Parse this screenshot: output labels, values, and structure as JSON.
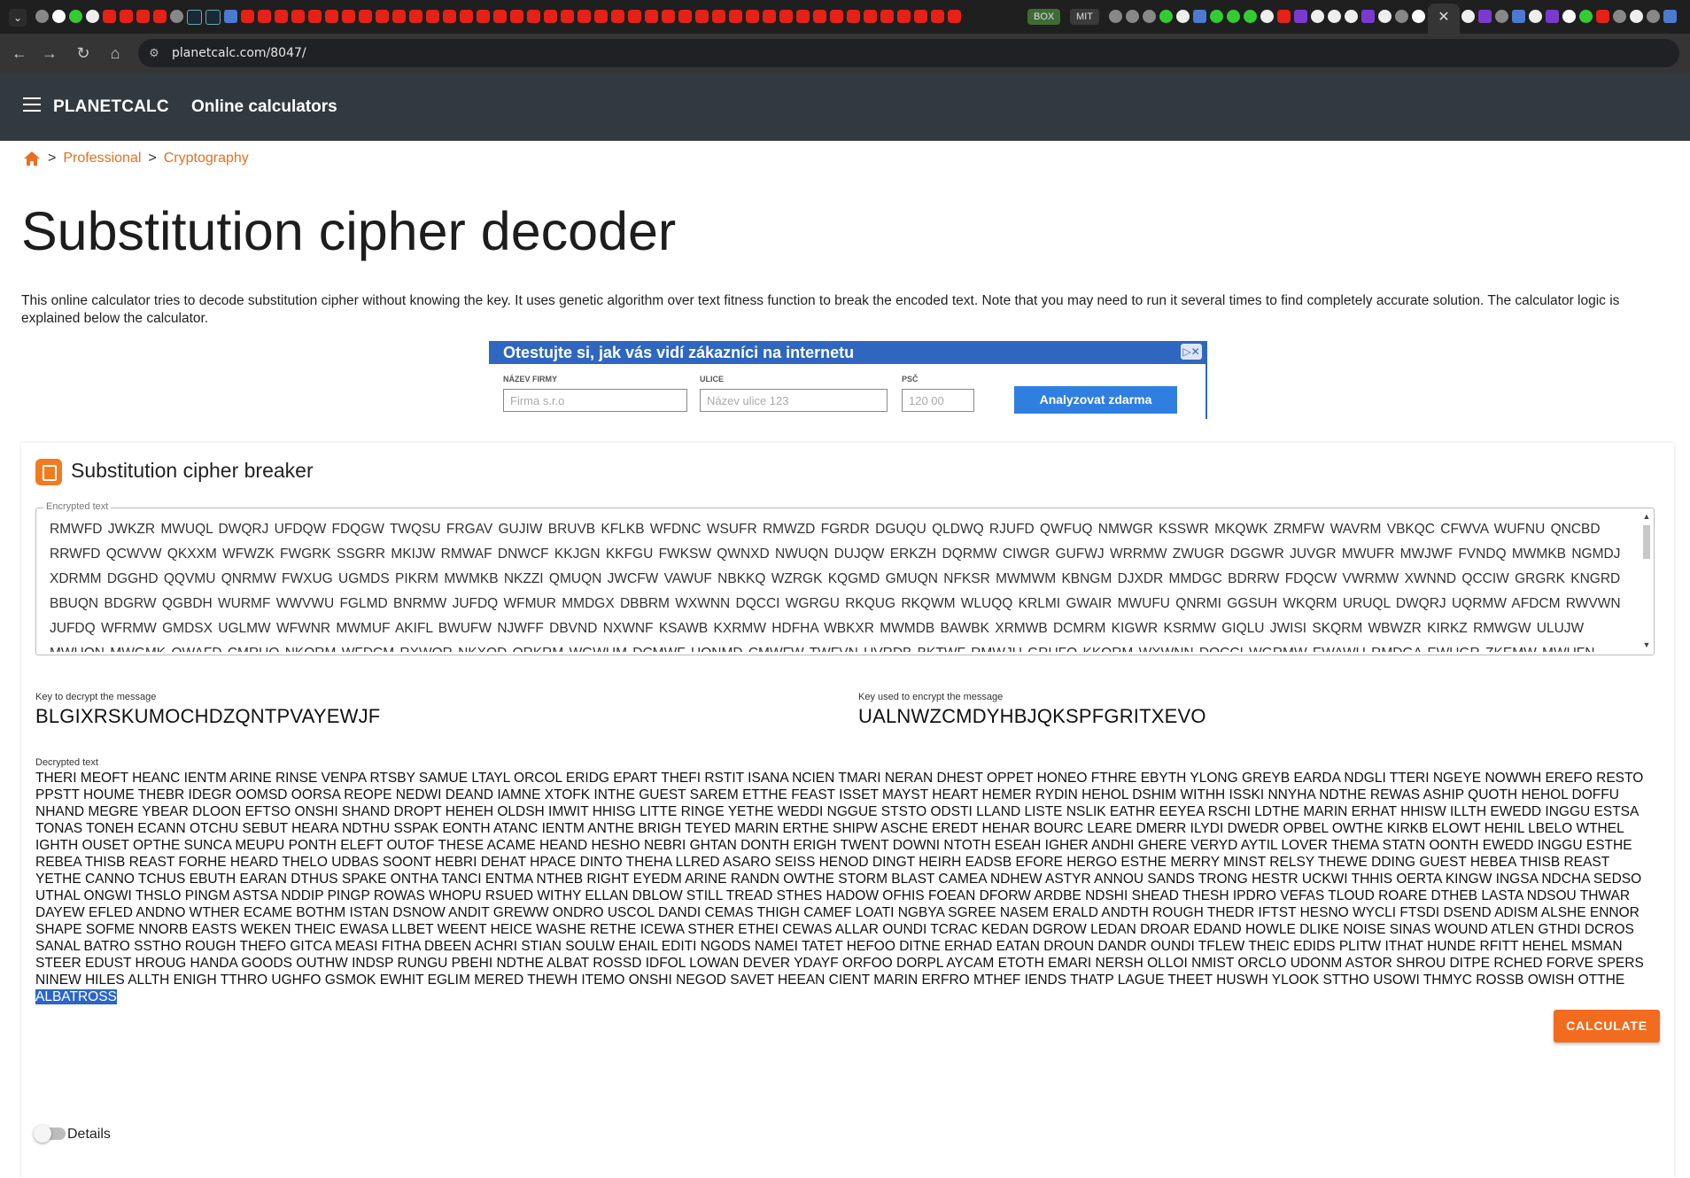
{
  "browser": {
    "tab_labels": {
      "box": "BOX",
      "mit": "MIT"
    },
    "active_tab_close": "✕",
    "url": "planetcalc.com/8047/"
  },
  "header": {
    "brand": "PLANETCALC",
    "nav_item": "Online calculators"
  },
  "breadcrumb": {
    "items": [
      "Professional",
      "Cryptography"
    ],
    "separator": ">"
  },
  "page": {
    "title": "Substitution cipher decoder",
    "intro": "This online calculator tries to decode substitution cipher without knowing the key. It uses genetic algorithm over text fitness function to break the encoded text. Note that you may need to run it several times to find completely accurate solution. The calculator logic is explained below the calculator."
  },
  "ad": {
    "title": "Otestujte si, jak vás vidí zákazníci na internetu",
    "close": "▷✕",
    "fields": [
      {
        "label": "NÁZEV FIRMY",
        "placeholder": "Firma s.r.o"
      },
      {
        "label": "ULICE",
        "placeholder": "Název ulice 123"
      },
      {
        "label": "PSČ",
        "placeholder": "120 00"
      }
    ],
    "button": "Analyzovat zdarma"
  },
  "calculator": {
    "title": "Substitution cipher breaker",
    "encrypted_label": "Encrypted text",
    "encrypted_text": "RMWFD JWKZR MWUQL DWQRJ UFDQW FDQGW TWQSU FRGAV GUJIW BRUVB KFLKB WFDNC WSUFR RMWZD FGRDR DGUQU QLDWQ RJUFD QWFUQ NMWGR KSSWR MKQWK ZRMFW WAVRM VBKQC CFWVA WUFNU QNCBD RRWFD QCWVW QKXXM WFWZK FWGRK SSGRR MKIJW RMWAF DNWCF KKJGN KKFGU FWKSW QWNXD NWUQN DUJQW ERKZH DQRMW CIWGR GUFWJ WRRMW ZWUGR DGGWR JUVGR MWUFR MWJWF FVNDQ MWMKB NGMDJ XDRMM DGGHD QQVMU QNRMW FWXUG UGMDS PIKRM MWMKB NKZZI QMUQN JWCFW VAWUF NBKKQ WZRGK KQGMD GMUQN NFKSR MWMWM KBNGM DJXDR MMDGC BDRRW FDQCW VWRMW XWNND QCCIW GRGRK KNGRD BBUQN BDGRW QGBDH WURMF WWVWU FGLMD BNRMW JUFDQ WFMUR MMDGX DBBRM WXWNN DQCCI WGRGU RKQUG RKQWM WLUQQ KRLMI GWAIR MWUFU QNRMI GGSUH WKQRM URUQL DWQRJ UQRMW AFDCM RWVWN JUFDQ WFRMW GMDSX UGLMW WFWNR MWMUF AKIFL BWUFW NJWFF DBVND NXWNF KSAWB KXRMW HDFHA WBKXR MWMDB BAWBK XRMWB DCMRM KIGWR KSRMW GIQLU JWISI SKQRM WBWZR KIRKZ RMWGW ULUJW MWUQN MWGMK QWAFD CMRUQ NKQRM WFDCM RXWQR NKXQD QRKRM WGWUM DCMWF UQNMD CMWFW TWFVN UVRDB BKTWF RMWJU GRUFQ KKQRM WXWNN DQCCI WGRMW EWAWU RMDGA EWUGR ZKEMW MWUFN RMWBK INAUG GKKQR MWAFD NWMUR MSULW NDQRK RMWMU BBEWN",
    "scroll_up": "▲",
    "scroll_down": "▼",
    "decrypt_key_label": "Key to decrypt the message",
    "decrypt_key": "BLGIXRSKUMOCHDZQNTPVAYEWJF",
    "encrypt_key_label": "Key used to encrypt the message",
    "encrypt_key": "UALNWZCMDYHBJQKSPFGRITXEVO",
    "decrypted_label": "Decrypted text",
    "decrypted_text": "THERI MEOFT HEANC IENTM ARINE RINSE VENPA RTSBY SAMUE LTAYL ORCOL ERIDG EPART THEFI RSTIT ISANA NCIEN TMARI NERAN DHEST OPPET HONEO FTHRE EBYTH YLONG GREYB EARDA NDGLI TTERI NGEYE NOWWH EREFO RESTO PPSTT HOUME THEBR IDEGR OOMSD OORSA REOPE NEDWI DEAND IAMNE XTOFK INTHE GUEST SAREM ETTHE FEAST ISSET MAYST HEART HEMER RYDIN HEHOL DSHIM WITHH ISSKI NNYHA NDTHE REWAS ASHIP QUOTH HEHOL DOFFU NHAND MEGRE YBEAR DLOON EFTSO ONSHI SHAND DROPT HEHEH OLDSH IMWIT HHISG LITTE RINGE YETHE WEDDI NGGUE STSTO ODSTI LLAND LISTE NSLIK EATHR EEYEA RSCHI LDTHE MARIN ERHAT HHISW ILLTH EWEDD INGGU ESTSA TONAS TONEH ECANN OTCHU SEBUT HEARA NDTHU SSPAK EONTH ATANC IENTM ANTHE BRIGH TEYED MARIN ERTHE SHIPW ASCHE EREDT HEHAR BOURC LEARE DMERR ILYDI DWEDR OPBEL OWTHE KIRKB ELOWT HEHIL LBELO WTHEL IGHTH OUSET OPTHE SUNCA MEUPU PONTH ELEFT OUTOF THESE ACAME HEAND HESHO NEBRI GHTAN DONTH ERIGH TWENT DOWNI NTOTH ESEAH IGHER ANDHI GHERE VERYD AYTIL LOVER THEMA STATN OONTH EWEDD INGGU ESTHE REBEA THISB REAST FORHE HEARD THELO UDBAS SOONT HEBRI DEHAT HPACE DINTO THEHA LLRED ASARO SEISS HENOD DINGT HEIRH EADSB EFORE HERGO ESTHE MERRY MINST RELSY THEWE DDING GUEST HEBEA THISB REAST YETHE CANNO TCHUS EBUTH EARAN DTHUS SPAKE ONTHA TANCI ENTMA NTHEB RIGHT EYEDM ARINE RANDN OWTHE STORM BLAST CAMEA NDHEW ASTYR ANNOU SANDS TRONG HESTR UCKWI THHIS OERTA KINGW INGSA NDCHA SEDSO UTHAL ONGWI THSLO PINGM ASTSA NDDIP PINGP ROWAS WHOPU RSUED WITHY ELLAN DBLOW STILL TREAD STHES HADOW OFHIS FOEAN DFORW ARDBE NDSHI SHEAD THESH IPDRO VEFAS TLOUD ROARE DTHEB LASTA NDSOU THWAR DAYEW EFLED ANDNO WTHER ECAME BOTHM ISTAN DSNOW ANDIT GREWW ONDRO USCOL DANDI CEMAS THIGH CAMEF LOATI NGBYA SGREE NASEM ERALD ANDTH ROUGH THEDR IFTST HESNO WYCLI FTSDI DSEND ADISM ALSHE ENNOR SHAPE SOFME NNORB EASTS WEKEN THEIC EWASA LLBET WEENT HEICE WASHE RETHE ICEWA STHER ETHEI CEWAS ALLAR OUNDI TCRAC KEDAN DGROW LEDAN DROAR EDAND HOWLE DLIKE NOISE SINAS WOUND ATLEN GTHDI DCROS SANAL BATRO SSTHO ROUGH THEFO GITCA MEASI FITHA DBEEN ACHRI STIAN SOULW EHAIL EDITI NGODS NAMEI TATET HEFOO DITNE ERHAD EATAN DROUN DANDR OUNDI TFLEW THEIC EDIDS PLITW ITHAT HUNDE RFITT HEHEL MSMAN STEER EDUST HROUG HANDA GOODS OUTHW INDSP RUNGU PBEHI NDTHE ALBAT ROSSD IDFOL LOWAN DEVER YDAYF ORFOO DORPL AYCAM ETOTH EMARI NERSH OLLOI NMIST ORCLO UDONM ASTOR SHROU DITPE RCHED FORVE SPERS NINEW HILES ALLTH ENIGH TTHRO UGHFO GSMOK EWHIT EGLIM MERED THEWH ITEMO ONSHI NEGOD SAVET HEEAN CIENT MARIN ERFRO MTHEF IENDS THATP LAGUE THEET HUSWH YLOOK STTHO USOWI THMYC ROSSB OWISH OTTHE",
    "decrypted_highlight": "ALBATROSS",
    "calculate_button": "CALCULATE",
    "details_label": "Details"
  },
  "colors": {
    "accent": "#f26c1f",
    "header_bg": "#323a40",
    "selection": "#2b65c9"
  }
}
